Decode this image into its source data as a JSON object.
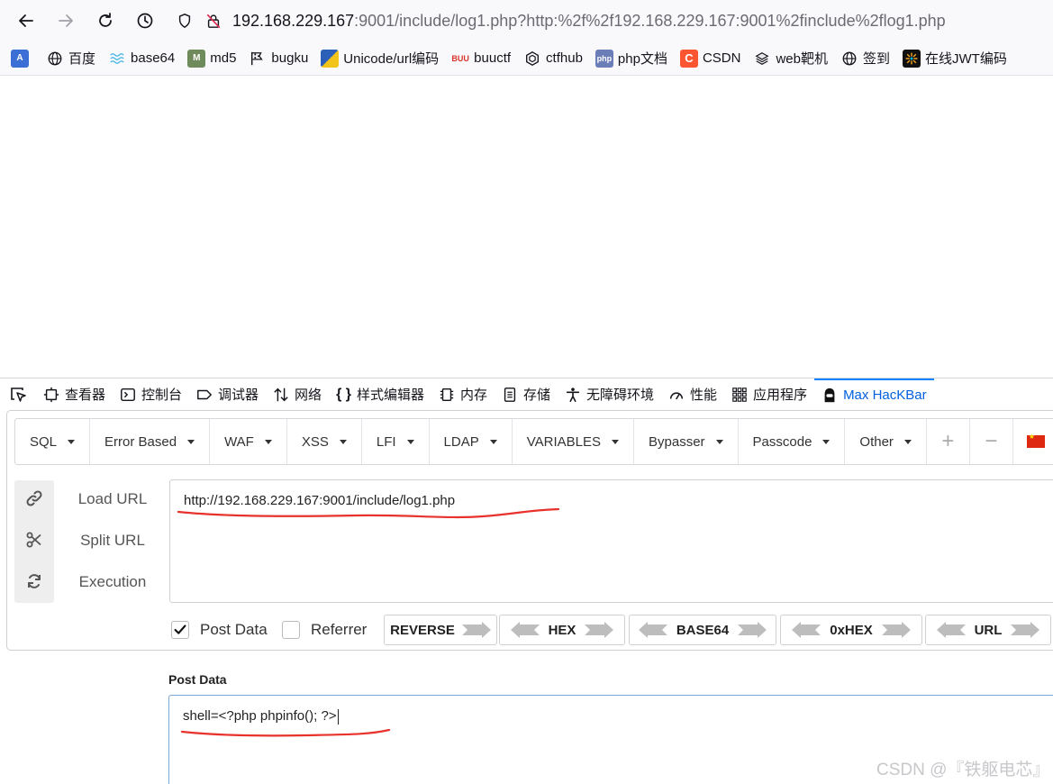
{
  "browser": {
    "url_host": "192.168.229.167",
    "url_rest": ":9001/include/log1.php?http:%2f%2f192.168.229.167:9001%2finclude%2flog1.php",
    "bookmarks": [
      {
        "label": "百度",
        "icon": "globe-icon"
      },
      {
        "label": "base64",
        "icon": "base64-icon"
      },
      {
        "label": "md5",
        "icon": "md5-icon"
      },
      {
        "label": "bugku",
        "icon": "flag-icon"
      },
      {
        "label": "Unicode/url编码",
        "icon": "unicode-icon"
      },
      {
        "label": "buuctf",
        "icon": "buuctf-icon"
      },
      {
        "label": "ctfhub",
        "icon": "ctfhub-icon"
      },
      {
        "label": "php文档",
        "icon": "php-icon"
      },
      {
        "label": "CSDN",
        "icon": "csdn-icon"
      },
      {
        "label": "web靶机",
        "icon": "layers-icon"
      },
      {
        "label": "签到",
        "icon": "globe-icon"
      },
      {
        "label": "在线JWT编码",
        "icon": "jwt-icon"
      }
    ]
  },
  "devtools": {
    "tabs": [
      {
        "label": "查看器",
        "icon": "inspector-icon"
      },
      {
        "label": "控制台",
        "icon": "console-icon"
      },
      {
        "label": "调试器",
        "icon": "debugger-icon"
      },
      {
        "label": "网络",
        "icon": "network-icon"
      },
      {
        "label": "样式编辑器",
        "icon": "style-editor-icon"
      },
      {
        "label": "内存",
        "icon": "memory-icon"
      },
      {
        "label": "存储",
        "icon": "storage-icon"
      },
      {
        "label": "无障碍环境",
        "icon": "accessibility-icon"
      },
      {
        "label": "性能",
        "icon": "performance-icon"
      },
      {
        "label": "应用程序",
        "icon": "application-icon"
      },
      {
        "label": "Max HacKBar",
        "icon": "hacker-icon"
      }
    ],
    "active_tab": "Max HacKBar"
  },
  "hackbar": {
    "menu": [
      "SQL",
      "Error Based",
      "WAF",
      "XSS",
      "LFI",
      "LDAP",
      "VARIABLES",
      "Bypasser",
      "Passcode",
      "Other"
    ],
    "plus": "+",
    "minus": "−",
    "actions": {
      "load": "Load URL",
      "split": "Split URL",
      "execute": "Execution"
    },
    "url_value": "http://192.168.229.167:9001/include/log1.php",
    "post_data_checked": true,
    "post_data_label": "Post Data",
    "referrer_checked": false,
    "referrer_label": "Referrer",
    "encoders": [
      "REVERSE",
      "HEX",
      "BASE64",
      "0xHEX",
      "URL"
    ]
  },
  "post_section": {
    "label": "Post Data",
    "value": "shell=<?php phpinfo(); ?>"
  },
  "watermark": "CSDN @『铁躯电芯』",
  "colors": {
    "accent": "#0a84ff",
    "annotation_red": "#e8322c"
  }
}
